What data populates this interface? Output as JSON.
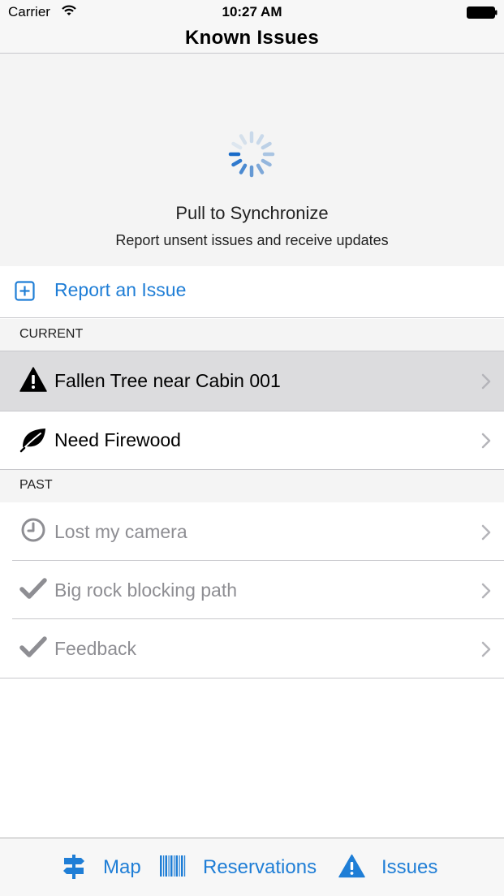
{
  "status_bar": {
    "carrier": "Carrier",
    "time": "10:27 AM"
  },
  "nav": {
    "title": "Known Issues"
  },
  "refresh": {
    "title": "Pull to Synchronize",
    "subtitle": "Report unsent issues and receive updates"
  },
  "report": {
    "label": "Report an Issue",
    "icon": "plus-square-icon"
  },
  "sections": {
    "current": {
      "header": "CURRENT",
      "items": [
        {
          "label": "Fallen Tree near Cabin 001",
          "icon": "warning-icon",
          "selected": true
        },
        {
          "label": "Need Firewood",
          "icon": "leaf-icon",
          "selected": false
        }
      ]
    },
    "past": {
      "header": "PAST",
      "items": [
        {
          "label": "Lost my camera",
          "icon": "clock-icon"
        },
        {
          "label": "Big rock blocking path",
          "icon": "checkmark-icon"
        },
        {
          "label": "Feedback",
          "icon": "checkmark-icon"
        }
      ]
    }
  },
  "tabs": [
    {
      "label": "Map",
      "icon": "signpost-icon"
    },
    {
      "label": "Reservations",
      "icon": "barcode-icon"
    },
    {
      "label": "Issues",
      "icon": "warning-icon"
    }
  ],
  "colors": {
    "accent": "#1f7ed6",
    "selected_row": "#dcdcde",
    "past_text": "#8e8e93",
    "section_bg": "#f4f4f4"
  }
}
